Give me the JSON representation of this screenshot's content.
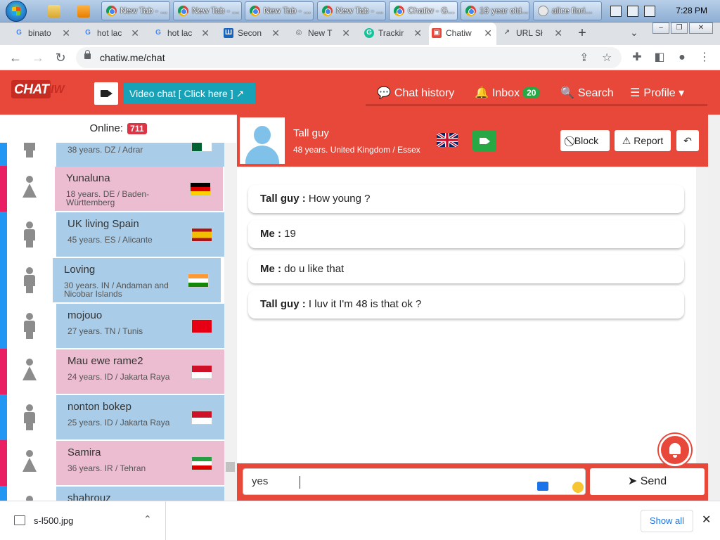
{
  "taskbar": {
    "windows": [
      {
        "title": "New Tab - ..."
      },
      {
        "title": "New Tab - ..."
      },
      {
        "title": "New Tab - ..."
      },
      {
        "title": "New Tab - ..."
      },
      {
        "title": "Chatiw - G..."
      },
      {
        "title": "19 year old..."
      },
      {
        "title": "alice flori..."
      }
    ],
    "clock": "7:28 PM"
  },
  "browser": {
    "tabs": [
      {
        "title": "binato",
        "favicon": "G",
        "color": "#4285f4"
      },
      {
        "title": "hot lac",
        "favicon": "G",
        "color": "#4285f4"
      },
      {
        "title": "hot lac",
        "favicon": "G",
        "color": "#4285f4"
      },
      {
        "title": "Secon",
        "favicon": "Ш",
        "color": "#1565c0"
      },
      {
        "title": "New T",
        "favicon": "◎",
        "color": "#5f6368"
      },
      {
        "title": "Trackir",
        "favicon": "G",
        "color": "#15c39a"
      },
      {
        "title": "Chatiw",
        "favicon": "▣",
        "color": "#e8483a"
      },
      {
        "title": "URL Sł",
        "favicon": "↗",
        "color": "#5f6368"
      }
    ],
    "url": "chatiw.me/chat"
  },
  "site": {
    "logo_text": "CHAT",
    "logo_text2": "IW",
    "video_chat_label": "Video chat  [ Click here ]",
    "nav": {
      "chat_history": "Chat history",
      "inbox": "Inbox",
      "inbox_count": "20",
      "search": "Search",
      "profile": "Profile"
    }
  },
  "sidebar": {
    "online_label": "Online:",
    "online_count": "711",
    "users": [
      {
        "name": "",
        "info": "38 years. DZ / Adrar",
        "gender": "male",
        "flag": "dz"
      },
      {
        "name": "Yunaluna",
        "info": "18 years. DE / Baden-Württemberg",
        "gender": "female",
        "flag": "de"
      },
      {
        "name": "UK living Spain",
        "info": "45 years. ES / Alicante",
        "gender": "male",
        "flag": "es"
      },
      {
        "name": "Loving",
        "info": "30 years. IN / Andaman and Nicobar Islands",
        "gender": "male",
        "flag": "in"
      },
      {
        "name": "mojouo",
        "info": "27 years. TN / Tunis",
        "gender": "male",
        "flag": "tn"
      },
      {
        "name": "Mau ewe rame2",
        "info": "24 years. ID / Jakarta Raya",
        "gender": "female",
        "flag": "id"
      },
      {
        "name": "nonton bokep",
        "info": "25 years. ID / Jakarta Raya",
        "gender": "male",
        "flag": "id"
      },
      {
        "name": "Samira",
        "info": "36 years. IR / Tehran",
        "gender": "female",
        "flag": "ir"
      },
      {
        "name": "shahrouz",
        "info": "",
        "gender": "male",
        "flag": ""
      }
    ]
  },
  "chat": {
    "partner": {
      "name": "Tall guy",
      "info": "48 years. United Kingdom / Essex"
    },
    "block_label": "Block",
    "report_label": "Report",
    "messages": [
      {
        "sender": "Tall guy :",
        "text": " How young ?"
      },
      {
        "sender": "Me :",
        "text": " 19"
      },
      {
        "sender": "Me :",
        "text": " do u like that"
      },
      {
        "sender": "Tall guy :",
        "text": " I luv it I'm 48 is that ok ?"
      }
    ],
    "input_value": "yes",
    "send_label": "Send"
  },
  "downloads": {
    "file_name": "s-l500.jpg",
    "show_all_label": "Show all"
  }
}
